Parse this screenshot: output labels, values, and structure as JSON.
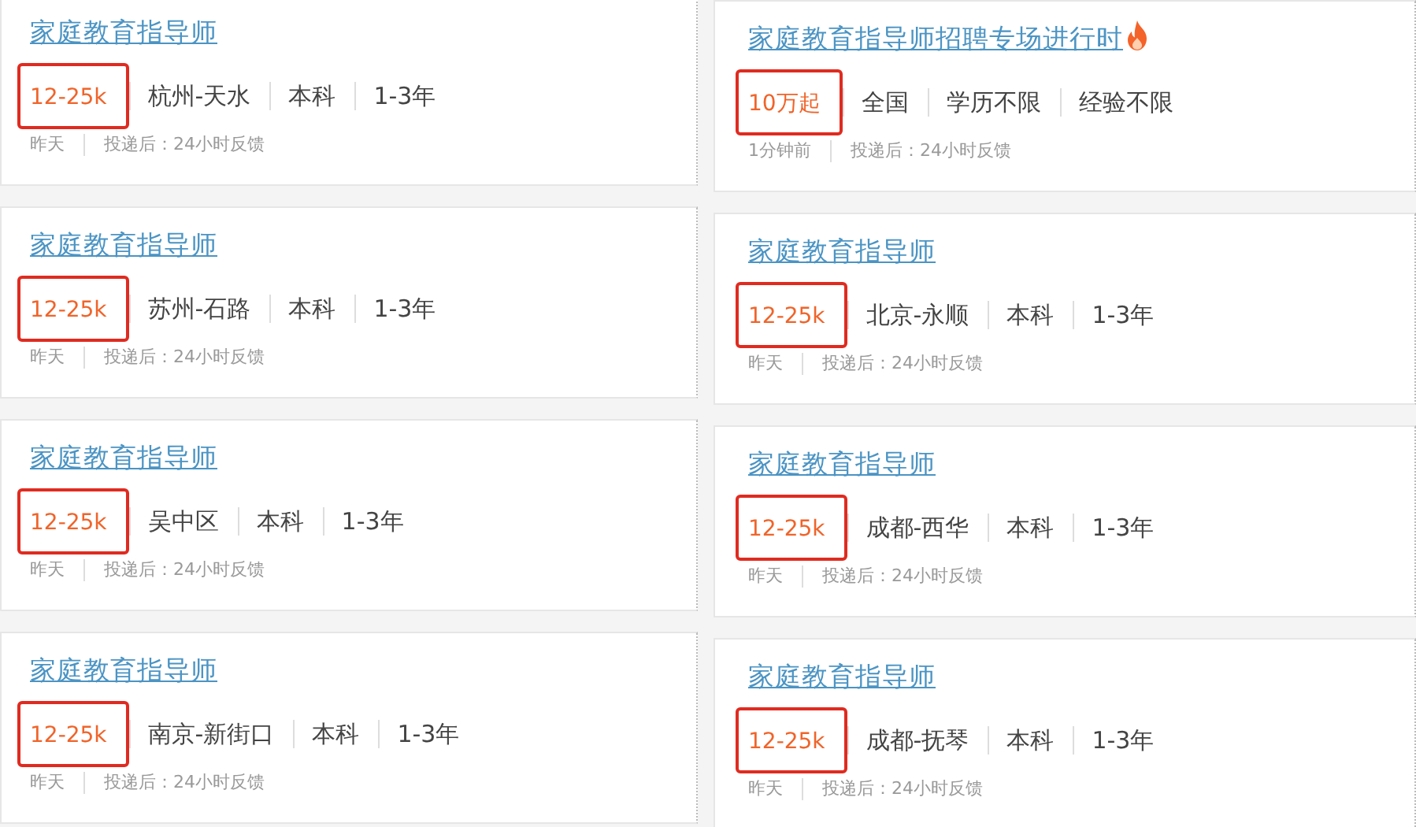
{
  "columns": [
    {
      "jobs": [
        {
          "title": "家庭教育指导师",
          "hot": false,
          "salary": "12-25k",
          "salary_highlighted": true,
          "tags": [
            "杭州-天水",
            "本科",
            "1-3年"
          ],
          "posted": "昨天",
          "feedback": "投递后：24小时反馈"
        },
        {
          "title": "家庭教育指导师",
          "hot": false,
          "salary": "12-25k",
          "salary_highlighted": true,
          "tags": [
            "苏州-石路",
            "本科",
            "1-3年"
          ],
          "posted": "昨天",
          "feedback": "投递后：24小时反馈"
        },
        {
          "title": "家庭教育指导师",
          "hot": false,
          "salary": "12-25k",
          "salary_highlighted": true,
          "tags": [
            "吴中区",
            "本科",
            "1-3年"
          ],
          "posted": "昨天",
          "feedback": "投递后：24小时反馈"
        },
        {
          "title": "家庭教育指导师",
          "hot": false,
          "salary": "12-25k",
          "salary_highlighted": true,
          "tags": [
            "南京-新街口",
            "本科",
            "1-3年"
          ],
          "posted": "昨天",
          "feedback": "投递后：24小时反馈"
        }
      ]
    },
    {
      "jobs": [
        {
          "title": "家庭教育指导师招聘专场进行时",
          "hot": true,
          "salary": "10万起",
          "salary_highlighted": true,
          "tags": [
            "全国",
            "学历不限",
            "经验不限"
          ],
          "posted": "1分钟前",
          "feedback": "投递后：24小时反馈"
        },
        {
          "title": "家庭教育指导师",
          "hot": false,
          "salary": "12-25k",
          "salary_highlighted": true,
          "tags": [
            "北京-永顺",
            "本科",
            "1-3年"
          ],
          "posted": "昨天",
          "feedback": "投递后：24小时反馈"
        },
        {
          "title": "家庭教育指导师",
          "hot": false,
          "salary": "12-25k",
          "salary_highlighted": true,
          "tags": [
            "成都-西华",
            "本科",
            "1-3年"
          ],
          "posted": "昨天",
          "feedback": "投递后：24小时反馈"
        },
        {
          "title": "家庭教育指导师",
          "hot": false,
          "salary": "12-25k",
          "salary_highlighted": true,
          "tags": [
            "成都-抚琴",
            "本科",
            "1-3年"
          ],
          "posted": "昨天",
          "feedback": "投递后：24小时反馈"
        }
      ]
    }
  ]
}
